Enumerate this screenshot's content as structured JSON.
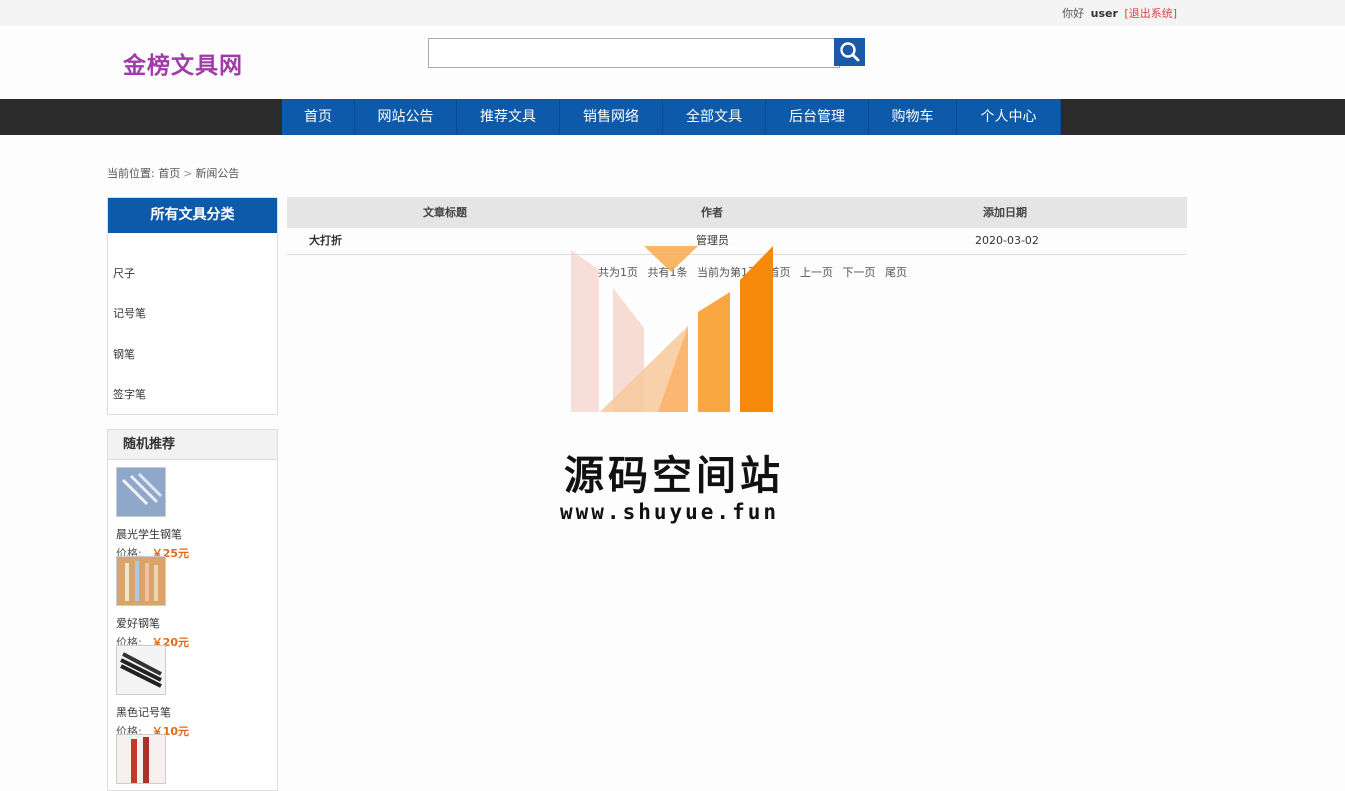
{
  "topbar": {
    "greeting": "你好",
    "username": "user",
    "logout_label": "[退出系统]"
  },
  "header": {
    "logo_text": "金榜文具网",
    "search_placeholder": ""
  },
  "nav": {
    "items": [
      {
        "label": "首页",
        "width": 72
      },
      {
        "label": "网站公告",
        "width": 101
      },
      {
        "label": "推荐文具",
        "width": 102
      },
      {
        "label": "销售网络",
        "width": 102
      },
      {
        "label": "全部文具",
        "width": 102
      },
      {
        "label": "后台管理",
        "width": 102
      },
      {
        "label": "购物车",
        "width": 87
      },
      {
        "label": "个人中心",
        "width": 103
      }
    ]
  },
  "breadcrumb": {
    "prefix": "当前位置:",
    "home": "首页",
    "separator": ">",
    "current": "新闻公告"
  },
  "sidebar": {
    "categories_title": "所有文具分类",
    "categories": [
      "尺子",
      "记号笔",
      "钢笔",
      "签字笔"
    ],
    "recommend_title": "随机推荐",
    "price_label": "价格:",
    "products": [
      {
        "name": "晨光学生钢笔",
        "price": "￥25元",
        "img_color": "#8fa7c9"
      },
      {
        "name": "爱好钢笔",
        "price": "￥20元",
        "img_color": "#d9a36a"
      },
      {
        "name": "黑色记号笔",
        "price": "￥10元",
        "img_color": "#333333"
      },
      {
        "name": "",
        "price": "",
        "img_color": "#c0392b"
      }
    ]
  },
  "table": {
    "columns": [
      "文章标题",
      "作者",
      "添加日期"
    ],
    "rows": [
      {
        "title": "大打折",
        "author": "管理员",
        "date": "2020-03-02"
      }
    ]
  },
  "pager": {
    "total_pages": "共为1页",
    "total_items": "共有1条",
    "current": "当前为第1页",
    "first": "首页",
    "prev": "上一页",
    "next": "下一页",
    "last": "尾页"
  },
  "watermark": {
    "title": "源码空间站",
    "url": "www.shuyue.fun"
  },
  "colors": {
    "brand": "#0e5aaa",
    "nav_bg": "#2b2b2b",
    "logo": "#a03ca8",
    "price": "#e06a1a"
  }
}
